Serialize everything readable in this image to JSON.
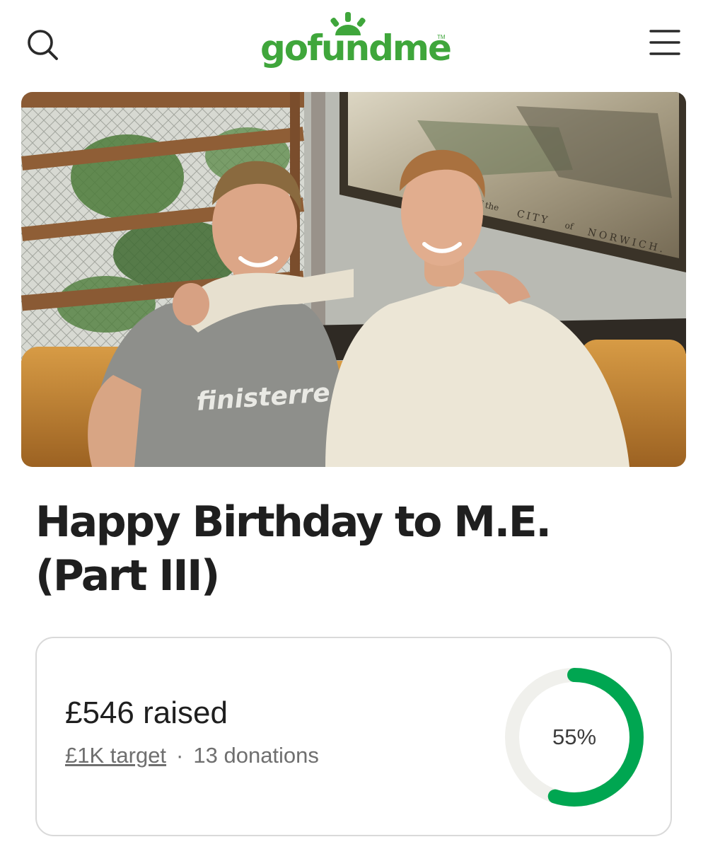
{
  "header": {
    "logo_text": "gofundme",
    "logo_tm": "TM",
    "search_icon": "search-icon",
    "menu_icon": "hamburger-menu-icon"
  },
  "hero": {
    "shirt_text": "finisterre",
    "map_caption_prefix": "of the",
    "map_caption_city": "CITY",
    "map_caption_of": "of",
    "map_caption_place": "NORWICH."
  },
  "campaign": {
    "title": "Happy Birthday to M.E. (Part III)",
    "raised_label": "£546 raised",
    "target_label": "£1K target",
    "separator": "·",
    "donations_label": "13 donations",
    "percent_label": "55%",
    "progress_fraction": 0.55
  },
  "colors": {
    "brand_green": "#3fa63b",
    "progress_green": "#00a651",
    "ring_track": "#f0f0ec"
  }
}
